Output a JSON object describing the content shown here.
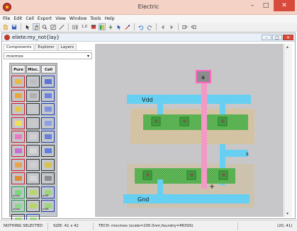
{
  "window": {
    "title": "Electric",
    "min_label": "–",
    "max_label": "□",
    "close_label": "✕"
  },
  "menu": [
    "File",
    "Edit",
    "Cell",
    "Export",
    "View",
    "Window",
    "Tools",
    "Help"
  ],
  "toolbar": {
    "icons": [
      "new-icon",
      "save-icon",
      "select-arrow-icon",
      "hand-pan-icon",
      "zoom-icon",
      "zoom-box-icon",
      "wire-tool-icon",
      "grid-icon",
      "scale-10-icon",
      "layer-fill-icon",
      "highlight-icon",
      "measure-icon",
      "pointer-icon",
      "pin-icon",
      "undo-icon",
      "redo-icon",
      "back-icon",
      "forward-icon",
      "cell-up-icon",
      "cell-down-icon"
    ],
    "scale_label": "1.0"
  },
  "document": {
    "title": "eliete:my_not{lay}",
    "min_label": "–",
    "max_label": "□",
    "close_label": "✕"
  },
  "panel": {
    "tabs": [
      "Components",
      "Explorer",
      "Layers"
    ],
    "technology": "mocmos",
    "headers": [
      "Pure",
      "Misc.",
      "Cell"
    ],
    "cells": [
      {
        "frame": "red",
        "chip": "#e8b84a"
      },
      {
        "frame": "black",
        "chip": "#bdbdbd"
      },
      {
        "frame": "blue",
        "chip": "#5b74d6"
      },
      {
        "frame": "red",
        "chip": "#e6a83c"
      },
      {
        "frame": "black",
        "chip": "#b0b0b0"
      },
      {
        "frame": "blue",
        "chip": "#6c84e0"
      },
      {
        "frame": "red",
        "chip": "#e6c64c"
      },
      {
        "frame": "black",
        "chip": "#c9c9c9"
      },
      {
        "frame": "blue",
        "chip": "#7d90e2"
      },
      {
        "frame": "red",
        "chip": "#f0df56"
      },
      {
        "frame": "black",
        "chip": "#c9c9c9"
      },
      {
        "frame": "blue",
        "chip": "#8f9fe6"
      },
      {
        "frame": "red",
        "chip": "#e87abf"
      },
      {
        "frame": "black",
        "chip": "#d0d0d0"
      },
      {
        "frame": "blue",
        "chip": "#6b7fd6"
      },
      {
        "frame": "red",
        "chip": "#c86fd0"
      },
      {
        "frame": "black",
        "chip": "#d6d6d6"
      },
      {
        "frame": "black",
        "chip": "#5f7fe0"
      },
      {
        "frame": "red",
        "chip": "#e8a24a"
      },
      {
        "frame": "black",
        "chip": "#d0d0d0"
      },
      {
        "frame": "black",
        "chip": "#d8c04a"
      },
      {
        "frame": "red",
        "chip": "#e08a3a"
      },
      {
        "frame": "black",
        "chip": "#d6d6d6"
      },
      {
        "frame": "black",
        "chip": "#8d8d8d"
      },
      {
        "frame": "green",
        "chip": "#7fd67f",
        "mini": "pmos"
      },
      {
        "frame": "black",
        "chip": "#b9d46a"
      },
      {
        "frame": "blue",
        "chip": "#9ad67a",
        "mini": "pdiff"
      },
      {
        "frame": "green",
        "chip": "#8fd68f",
        "mini": "nmos"
      },
      {
        "frame": "black",
        "chip": "#b9d46a"
      },
      {
        "frame": "blue",
        "chip": "#9ad67a",
        "mini": "ndiff"
      },
      {
        "frame": "black",
        "chip": "#9ad67a",
        "mini": "pwell"
      },
      {
        "frame": "blue",
        "chip": "#9ad67a",
        "mini": "nwell"
      }
    ]
  },
  "layout": {
    "labels": {
      "a": "a",
      "vdd": "Vdd",
      "s": "s",
      "gnd": "Gnd"
    },
    "colors": {
      "background": "#c7c7c9",
      "metal1": "#67d0f2",
      "poly": "#f299c6",
      "active": "#3da03d",
      "select": "#d8ccb4",
      "contact": "#6a6a4a",
      "pin": "#8c8c8c",
      "pin_outline": "#ff66c4"
    }
  },
  "status": {
    "selection": "NOTHING SELECTED",
    "size": "SIZE: 41 x 42",
    "tech": "TECH: mocmos (scale=200.0nm,foundry=MOSIS)",
    "coords": "(20, 41)"
  }
}
